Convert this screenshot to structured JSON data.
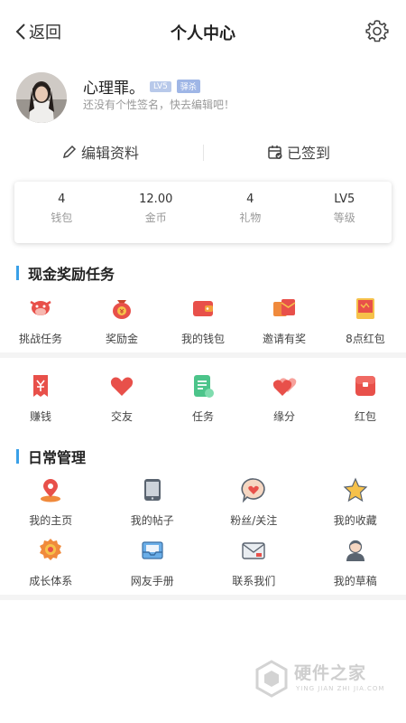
{
  "nav": {
    "back_label": "返回",
    "title": "个人中心"
  },
  "profile": {
    "username": "心理罪。",
    "level_badge": "LV5",
    "tag_badge": "驿杀",
    "signature": "还没有个性签名，快去编辑吧！"
  },
  "actions": {
    "edit_label": "编辑资料",
    "signin_label": "已签到"
  },
  "stats": [
    {
      "value": "4",
      "label": "钱包"
    },
    {
      "value": "12.00",
      "label": "金币"
    },
    {
      "value": "4",
      "label": "礼物"
    },
    {
      "value": "LV5",
      "label": "等级"
    }
  ],
  "cash_section": {
    "title": "现金奖励任务",
    "row1": [
      {
        "label": "挑战任务",
        "icon": "cow-icon"
      },
      {
        "label": "奖励金",
        "icon": "money-bag-icon"
      },
      {
        "label": "我的钱包",
        "icon": "wallet-icon"
      },
      {
        "label": "邀请有奖",
        "icon": "red-envelope-invite-icon"
      },
      {
        "label": "8点红包",
        "icon": "red-packet-icon"
      }
    ],
    "row2": [
      {
        "label": "赚钱",
        "icon": "yuan-ticket-icon"
      },
      {
        "label": "交友",
        "icon": "heart-icon"
      },
      {
        "label": "任务",
        "icon": "task-list-icon"
      },
      {
        "label": "缘分",
        "icon": "double-heart-icon"
      },
      {
        "label": "红包",
        "icon": "red-bag-icon"
      }
    ]
  },
  "daily_section": {
    "title": "日常管理",
    "row1": [
      {
        "label": "我的主页",
        "icon": "location-pin-icon"
      },
      {
        "label": "我的帖子",
        "icon": "tablet-icon"
      },
      {
        "label": "粉丝/关注",
        "icon": "heart-bubble-icon"
      },
      {
        "label": "我的收藏",
        "icon": "star-icon"
      }
    ],
    "row2": [
      {
        "label": "成长体系",
        "icon": "medal-icon"
      },
      {
        "label": "网友手册",
        "icon": "inbox-icon"
      },
      {
        "label": "联系我们",
        "icon": "mail-icon"
      },
      {
        "label": "我的草稿",
        "icon": "person-icon"
      }
    ]
  },
  "watermark": {
    "text": "硬件之家",
    "sub": "YING JIAN ZHI JIA.COM"
  },
  "colors": {
    "accent": "#3aa0e8",
    "red": "#e8504a",
    "orange": "#f08a3c",
    "green": "#4cc48a"
  }
}
